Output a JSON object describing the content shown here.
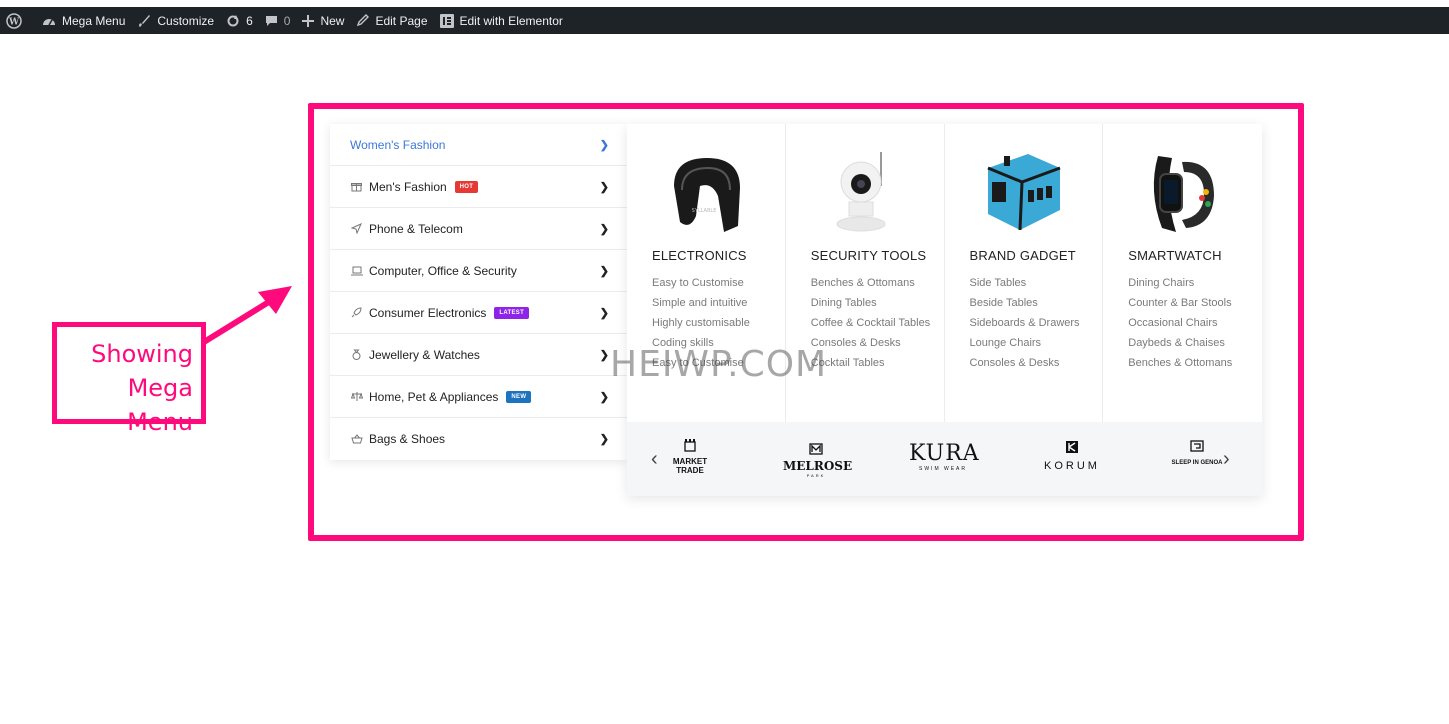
{
  "adminbar": {
    "site_name": "Mega Menu",
    "customize": "Customize",
    "updates_count": "6",
    "comments_count": "0",
    "new_label": "New",
    "edit_page": "Edit Page",
    "edit_elementor": "Edit with Elementor"
  },
  "annotation": {
    "line1": "Showing",
    "line2": "Mega Menu",
    "color": "#ff0a7c"
  },
  "sidebar": {
    "items": [
      {
        "label": "Women's Fashion",
        "icon": "none",
        "active": true
      },
      {
        "label": "Men's Fashion",
        "icon": "gift-icon",
        "badge": "HOT"
      },
      {
        "label": "Phone & Telecom",
        "icon": "paper-plane-icon"
      },
      {
        "label": "Computer, Office & Security",
        "icon": "laptop-icon"
      },
      {
        "label": "Consumer Electronics",
        "icon": "rocket-icon",
        "badge": "LATEST"
      },
      {
        "label": "Jewellery & Watches",
        "icon": "ring-icon"
      },
      {
        "label": "Home, Pet & Appliances",
        "icon": "scales-icon",
        "badge": "NEW"
      },
      {
        "label": "Bags & Shoes",
        "icon": "basket-icon"
      }
    ]
  },
  "mega": {
    "columns": [
      {
        "title": "ELECTRONICS",
        "image": "earbud-icon",
        "links": [
          "Easy to Customise",
          "Simple and intuitive",
          "Highly customisable",
          "Coding skills",
          "Easy to Customise"
        ]
      },
      {
        "title": "SECURITY TOOLS",
        "image": "security-camera-icon",
        "links": [
          "Benches & Ottomans",
          "Dining Tables",
          "Coffee & Cocktail Tables",
          "Consoles & Desks",
          "Cocktail Tables"
        ]
      },
      {
        "title": "BRAND GADGET",
        "image": "travel-adapter-icon",
        "links": [
          "Side Tables",
          "Beside Tables",
          "Sideboards & Drawers",
          "Lounge Chairs",
          "Consoles & Desks"
        ]
      },
      {
        "title": "SMARTWATCH",
        "image": "fitness-band-icon",
        "links": [
          "Dining Chairs",
          "Counter & Bar Stools",
          "Occasional Chairs",
          "Daybeds & Chaises",
          "Benches & Ottomans"
        ]
      }
    ],
    "brands": [
      {
        "name": "MARKET",
        "sub": "TRADE"
      },
      {
        "name": "MELROSE",
        "sub": "PARK"
      },
      {
        "name": "KURA",
        "sub": "SWIM WEAR"
      },
      {
        "name": "KORUM",
        "sub": ""
      },
      {
        "name": "SLEEP IN GENOA",
        "sub": ""
      }
    ]
  },
  "watermark": "HEIWP.COM"
}
